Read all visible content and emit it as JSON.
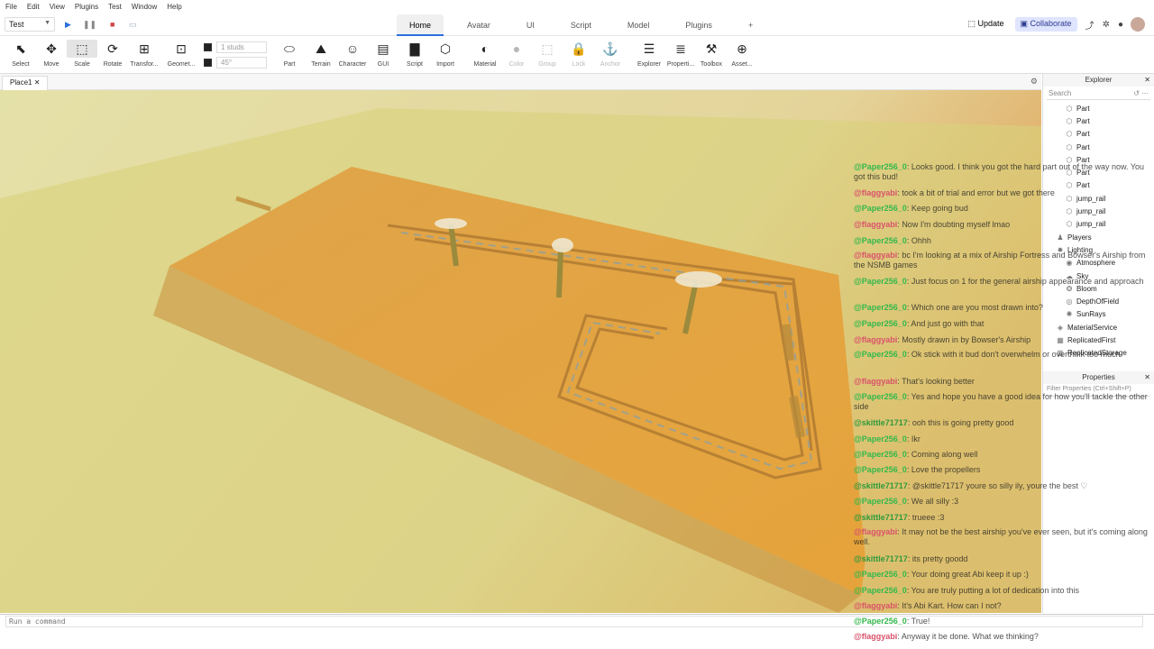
{
  "menubar": {
    "items": [
      "File",
      "Edit",
      "View",
      "Plugins",
      "Test",
      "Window",
      "Help"
    ]
  },
  "topbar": {
    "context": "Test",
    "tabs": [
      "Home",
      "Avatar",
      "UI",
      "Script",
      "Model",
      "Plugins",
      "+"
    ],
    "active_tab": "Home",
    "update_label": "Update",
    "collaborate_label": "Collaborate"
  },
  "ribbon": {
    "tools": [
      {
        "label": "Select",
        "icon": "cursor-icon"
      },
      {
        "label": "Move",
        "icon": "move-icon"
      },
      {
        "label": "Scale",
        "icon": "scale-icon"
      },
      {
        "label": "Rotate",
        "icon": "rotate-icon"
      },
      {
        "label": "Transfor...",
        "icon": "transform-icon"
      },
      {
        "label": "Geomet...",
        "icon": "geometry-icon"
      },
      {
        "label": "Part",
        "icon": "part-icon"
      },
      {
        "label": "Terrain",
        "icon": "terrain-icon"
      },
      {
        "label": "Character",
        "icon": "character-icon"
      },
      {
        "label": "GUI",
        "icon": "gui-icon"
      },
      {
        "label": "Script",
        "icon": "script-icon"
      },
      {
        "label": "Import",
        "icon": "import-icon"
      },
      {
        "label": "Material",
        "icon": "material-icon"
      },
      {
        "label": "Color",
        "icon": "color-icon"
      },
      {
        "label": "Group",
        "icon": "group-icon"
      },
      {
        "label": "Lock",
        "icon": "lock-icon"
      },
      {
        "label": "Anchor",
        "icon": "anchor-icon"
      },
      {
        "label": "Explorer",
        "icon": "explorer-icon"
      },
      {
        "label": "Properti...",
        "icon": "properties-icon"
      },
      {
        "label": "Toolbox",
        "icon": "toolbox-icon"
      },
      {
        "label": "Asset...",
        "icon": "asset-icon"
      }
    ],
    "snap_move": "1 studs",
    "snap_rotate": "45°"
  },
  "doc": {
    "tab": "Place1"
  },
  "explorer": {
    "title": "Explorer",
    "search_placeholder": "Search",
    "items": [
      {
        "label": "Part",
        "depth": 2,
        "icon": "part-icon"
      },
      {
        "label": "Part",
        "depth": 2,
        "icon": "part-icon"
      },
      {
        "label": "Part",
        "depth": 2,
        "icon": "part-icon"
      },
      {
        "label": "Part",
        "depth": 2,
        "icon": "part-icon"
      },
      {
        "label": "Part",
        "depth": 2,
        "icon": "part-icon"
      },
      {
        "label": "Part",
        "depth": 2,
        "icon": "part-icon"
      },
      {
        "label": "Part",
        "depth": 2,
        "icon": "part-icon"
      },
      {
        "label": "jump_rail",
        "depth": 2,
        "icon": "part-icon"
      },
      {
        "label": "jump_rail",
        "depth": 2,
        "icon": "part-icon"
      },
      {
        "label": "jump_rail",
        "depth": 2,
        "icon": "part-icon"
      },
      {
        "label": "Players",
        "depth": 1,
        "icon": "players-icon"
      },
      {
        "label": "Lighting",
        "depth": 1,
        "icon": "lighting-icon"
      },
      {
        "label": "Atmosphere",
        "depth": 2,
        "icon": "atmosphere-icon"
      },
      {
        "label": "Sky",
        "depth": 2,
        "icon": "sky-icon"
      },
      {
        "label": "Bloom",
        "depth": 2,
        "icon": "bloom-icon"
      },
      {
        "label": "DepthOfField",
        "depth": 2,
        "icon": "depth-of-field-icon"
      },
      {
        "label": "SunRays",
        "depth": 2,
        "icon": "sunrays-icon"
      },
      {
        "label": "MaterialService",
        "depth": 1,
        "icon": "material-service-icon"
      },
      {
        "label": "ReplicatedFirst",
        "depth": 1,
        "icon": "replicated-first-icon"
      },
      {
        "label": "ReplicatedStorage",
        "depth": 1,
        "icon": "replicated-storage-icon"
      }
    ]
  },
  "properties": {
    "title": "Properties",
    "filter_placeholder": "Filter Properties (Ctrl+Shift+P)"
  },
  "command": {
    "placeholder": "Run a command"
  },
  "chat": [
    {
      "name": "@Paper256_0",
      "text": "Looks good. I think you got the hard part out of the way now. You got this bud!",
      "color": "paper"
    },
    {
      "name": "@flaggyabi",
      "text": "took a bit of trial and error but we got there",
      "color": "flaggy"
    },
    {
      "name": "@Paper256_0",
      "text": "Keep going bud",
      "color": "paper"
    },
    {
      "name": "@flaggyabi",
      "text": "Now I'm doubting myself lmao",
      "color": "flaggy"
    },
    {
      "name": "@Paper256_0",
      "text": "Ohhh",
      "color": "paper"
    },
    {
      "name": "@flaggyabi",
      "text": "bc I'm looking at a mix of Airship Fortress and Bowser's Airship from the NSMB games",
      "color": "flaggy"
    },
    {
      "name": "@Paper256_0",
      "text": "Just focus on 1 for the general airship appearance and approach",
      "color": "paper"
    },
    {
      "name": "@Paper256_0",
      "text": "Which one are you most drawn into?",
      "color": "paper"
    },
    {
      "name": "@Paper256_0",
      "text": "And just go with that",
      "color": "paper"
    },
    {
      "name": "@flaggyabi",
      "text": "Mostly drawn in by Bowser's Airship",
      "color": "flaggy"
    },
    {
      "name": "@Paper256_0",
      "text": "Ok stick with it bud don't overwhelm or overthink too much",
      "color": "paper"
    },
    {
      "name": "@flaggyabi",
      "text": "That's looking better",
      "color": "flaggy"
    },
    {
      "name": "@Paper256_0",
      "text": "Yes and hope you have a good idea for how you'll tackle the other side",
      "color": "paper"
    },
    {
      "name": "@skittle71717",
      "text": "ooh this is going pretty good",
      "color": "skittle"
    },
    {
      "name": "@Paper256_0",
      "text": "Ikr",
      "color": "paper"
    },
    {
      "name": "@Paper256_0",
      "text": "Coming along well",
      "color": "paper"
    },
    {
      "name": "@Paper256_0",
      "text": "Love the propellers",
      "color": "paper"
    },
    {
      "name": "@skittle71717",
      "text": "@skittle71717 youre so silly ily, youre the best ♡",
      "color": "skittle"
    },
    {
      "name": "@Paper256_0",
      "text": "We all silly :3",
      "color": "paper"
    },
    {
      "name": "@skittle71717",
      "text": "trueee :3",
      "color": "skittle"
    },
    {
      "name": "@flaggyabi",
      "text": "It may not be the best airship you've ever seen, but it's coming along well.",
      "color": "flaggy"
    },
    {
      "name": "@skittle71717",
      "text": "its pretty goodd",
      "color": "skittle"
    },
    {
      "name": "@Paper256_0",
      "text": "Your doing great Abi keep it up :)",
      "color": "paper"
    },
    {
      "name": "@Paper256_0",
      "text": "You are truly putting a lot of dedication into this",
      "color": "paper"
    },
    {
      "name": "@flaggyabi",
      "text": "It's Abi Kart. How can I not?",
      "color": "flaggy"
    },
    {
      "name": "@Paper256_0",
      "text": "True!",
      "color": "paper"
    },
    {
      "name": "@flaggyabi",
      "text": "Anyway it be done. What we thinking?",
      "color": "flaggy"
    }
  ],
  "colors": {
    "accent": "#2a6fdb",
    "viewport_sky": "#e4dc9a",
    "deck": "#e2a23b",
    "flaggy": "#d9526a",
    "paper": "#34b84b",
    "skittle": "#2e9a3b"
  }
}
